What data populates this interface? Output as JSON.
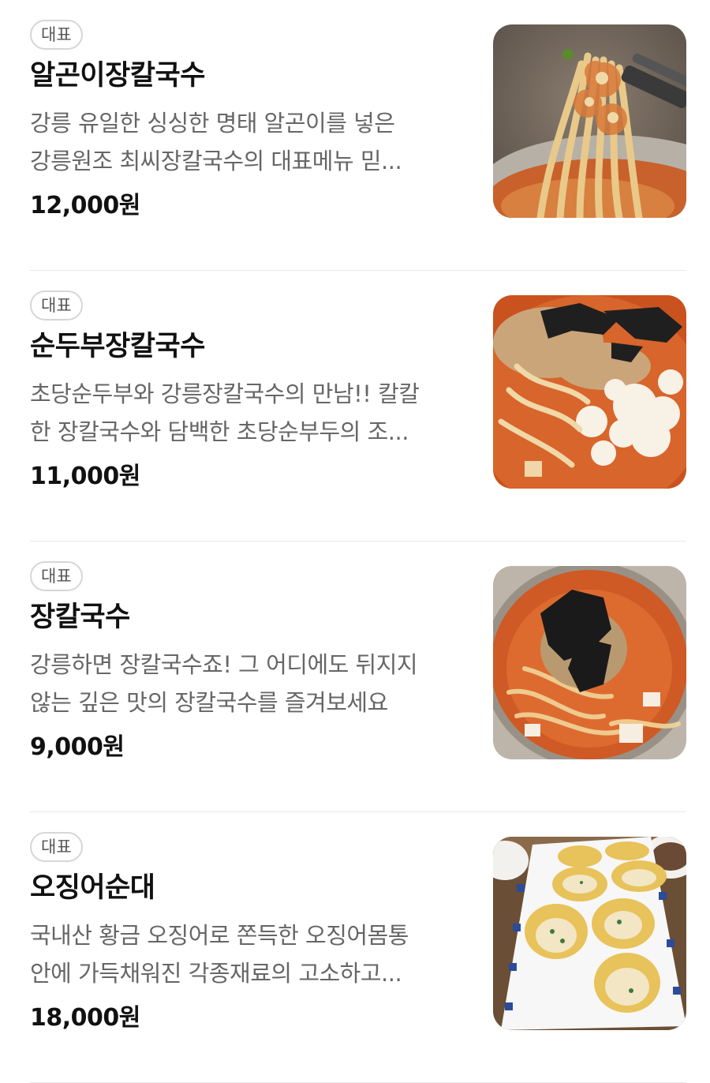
{
  "menu": {
    "items": [
      {
        "badge": "대표",
        "name": "알곤이장칼국수",
        "desc_line1": "강릉 유일한 싱싱한 명태 알곤이를 넣은",
        "desc_line2": "강릉원조 최씨장칼국수의 대표메뉴 믿...",
        "price": "12,000원",
        "image_icon": "noodle-lift-photo"
      },
      {
        "badge": "대표",
        "name": "순두부장칼국수",
        "desc_line1": "초당순두부와 강릉장칼국수의 만남!! 칼칼",
        "desc_line2": "한 장칼국수와 담백한 초당순부두의 조...",
        "price": "11,000원",
        "image_icon": "tofu-noodle-soup-photo"
      },
      {
        "badge": "대표",
        "name": "장칼국수",
        "desc_line1": "강릉하면 장칼국수죠! 그 어디에도 뒤지지",
        "desc_line2": "않는 깊은 맛의 장칼국수를 즐겨보세요",
        "price": "9,000원",
        "image_icon": "noodle-soup-bowl-photo"
      },
      {
        "badge": "대표",
        "name": "오징어순대",
        "desc_line1": "국내산 황금 오징어로 쫀득한 오징어몸통",
        "desc_line2": "안에 가득채워진 각종재료의 고소하고...",
        "price": "18,000원",
        "image_icon": "squid-sundae-plate-photo"
      }
    ]
  },
  "colors": {
    "badge_border": "#d6d6d6",
    "text_primary": "#111111",
    "text_secondary": "#666666",
    "divider": "#e9e9e9"
  }
}
